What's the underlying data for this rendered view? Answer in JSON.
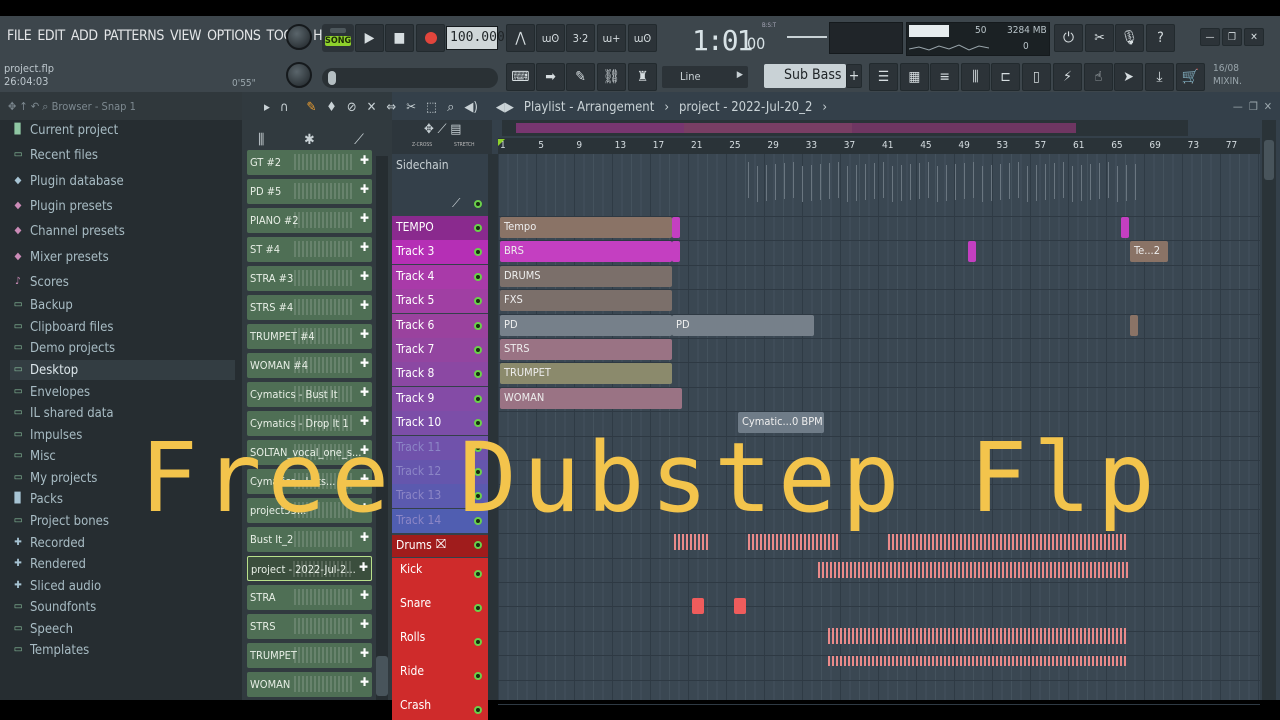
{
  "menu": [
    "FILE",
    "EDIT",
    "ADD",
    "PATTERNS",
    "VIEW",
    "OPTIONS",
    "TOOLS",
    "HELP"
  ],
  "project": {
    "name": "project.flp",
    "time": "26:04:03",
    "duration": "0'55\""
  },
  "transport": {
    "mode": "SONG",
    "tempo": "100.000",
    "time": "1:01",
    "ticks": "00",
    "bst": "B:S:T"
  },
  "cpu": {
    "voices": "50",
    "mem": "3284 MB",
    "val2": "0"
  },
  "tool": {
    "line": "Line",
    "channel": "Sub Bass",
    "date": "16/08",
    "mixer": "MIXIN."
  },
  "browser": {
    "title": "Browser - Snap 1",
    "items": [
      {
        "label": "Current project",
        "icon": "project-icon"
      },
      {
        "label": "Recent files",
        "icon": "folder-icon"
      },
      {
        "label": "Plugin database",
        "icon": "plugin-icon"
      },
      {
        "label": "Plugin presets",
        "icon": "preset-icon"
      },
      {
        "label": "Channel presets",
        "icon": "channel-icon"
      },
      {
        "label": "Mixer presets",
        "icon": "mixer-icon"
      },
      {
        "label": "Scores",
        "icon": "note-icon"
      },
      {
        "label": "Backup",
        "icon": "folder-icon"
      },
      {
        "label": "Clipboard files",
        "icon": "folder-icon"
      },
      {
        "label": "Demo projects",
        "icon": "folder-icon"
      },
      {
        "label": "Desktop",
        "icon": "folder-icon"
      },
      {
        "label": "Envelopes",
        "icon": "folder-icon"
      },
      {
        "label": "IL shared data",
        "icon": "folder-icon"
      },
      {
        "label": "Impulses",
        "icon": "folder-icon"
      },
      {
        "label": "Misc",
        "icon": "folder-icon"
      },
      {
        "label": "My projects",
        "icon": "folder-icon"
      },
      {
        "label": "Packs",
        "icon": "pack-icon"
      },
      {
        "label": "Project bones",
        "icon": "folder-icon"
      },
      {
        "label": "Recorded",
        "icon": "plus-icon"
      },
      {
        "label": "Rendered",
        "icon": "plus-icon"
      },
      {
        "label": "Sliced audio",
        "icon": "plus-icon"
      },
      {
        "label": "Soundfonts",
        "icon": "folder-icon"
      },
      {
        "label": "Speech",
        "icon": "folder-icon"
      },
      {
        "label": "Templates",
        "icon": "folder-icon"
      }
    ]
  },
  "patterns": [
    "GT #2",
    "PD #5",
    "PIANO #2",
    "ST #4",
    "STRA #3",
    "STRS #4",
    "TRUMPET #4",
    "WOMAN #4",
    "Cymatics - Bust It",
    "Cymatics - Drop It 1",
    "SOLTAN_vocal_one_s...",
    "Cymatics - Lets...",
    "project55...",
    "Bust It_2",
    "project - 2022-Jul-2...",
    "STRA",
    "STRS",
    "TRUMPET",
    "WOMAN"
  ],
  "playlist": {
    "title": "Playlist - Arrangement",
    "breadcrumb": "project - 2022-Jul-20_2",
    "zcross": "Z-CROSS",
    "stretch": "STRETCH",
    "sidechain": "Sidechain",
    "bars": [
      "1",
      "5",
      "9",
      "13",
      "17",
      "21",
      "25",
      "29",
      "33",
      "37",
      "41",
      "45",
      "49",
      "53",
      "57",
      "61",
      "65",
      "69",
      "73",
      "77"
    ]
  },
  "tracks": [
    {
      "label": "TEMPO",
      "color": "#8a2a8e"
    },
    {
      "label": "Track 3",
      "color": "#b52fb5"
    },
    {
      "label": "Track 4",
      "color": "#a93aa9"
    },
    {
      "label": "Track 5",
      "color": "#a03fa3"
    },
    {
      "label": "Track 6",
      "color": "#9a429e"
    },
    {
      "label": "Track 7",
      "color": "#9345a0"
    },
    {
      "label": "Track 8",
      "color": "#8b48a3"
    },
    {
      "label": "Track 9",
      "color": "#844ba6"
    },
    {
      "label": "Track 10",
      "color": "#7c4ea8"
    },
    {
      "label": "Track 11",
      "color": "#7052ab"
    },
    {
      "label": "Track 12",
      "color": "#6556ad"
    },
    {
      "label": "Track 13",
      "color": "#5b5aaf"
    },
    {
      "label": "Track 14",
      "color": "#505eb1"
    }
  ],
  "clips": [
    {
      "label": "Tempo",
      "row": 0
    },
    {
      "label": "BRS",
      "row": 1
    },
    {
      "label": "DRUMS",
      "row": 2
    },
    {
      "label": "FXS",
      "row": 3
    },
    {
      "label": "PD",
      "row": 4
    },
    {
      "label": "PD",
      "row": 4
    },
    {
      "label": "STRS",
      "row": 5
    },
    {
      "label": "TRUMPET",
      "row": 6
    },
    {
      "label": "WOMAN",
      "row": 7
    },
    {
      "label": "Cymatic...0 BPM",
      "row": 8
    },
    {
      "label": "Te...2",
      "row": 1
    }
  ],
  "drums": {
    "title": "Drums",
    "rows": [
      "Kick",
      "Snare",
      "Rolls",
      "Ride",
      "Crash"
    ]
  },
  "overlay": "Free Dubstep Flp"
}
